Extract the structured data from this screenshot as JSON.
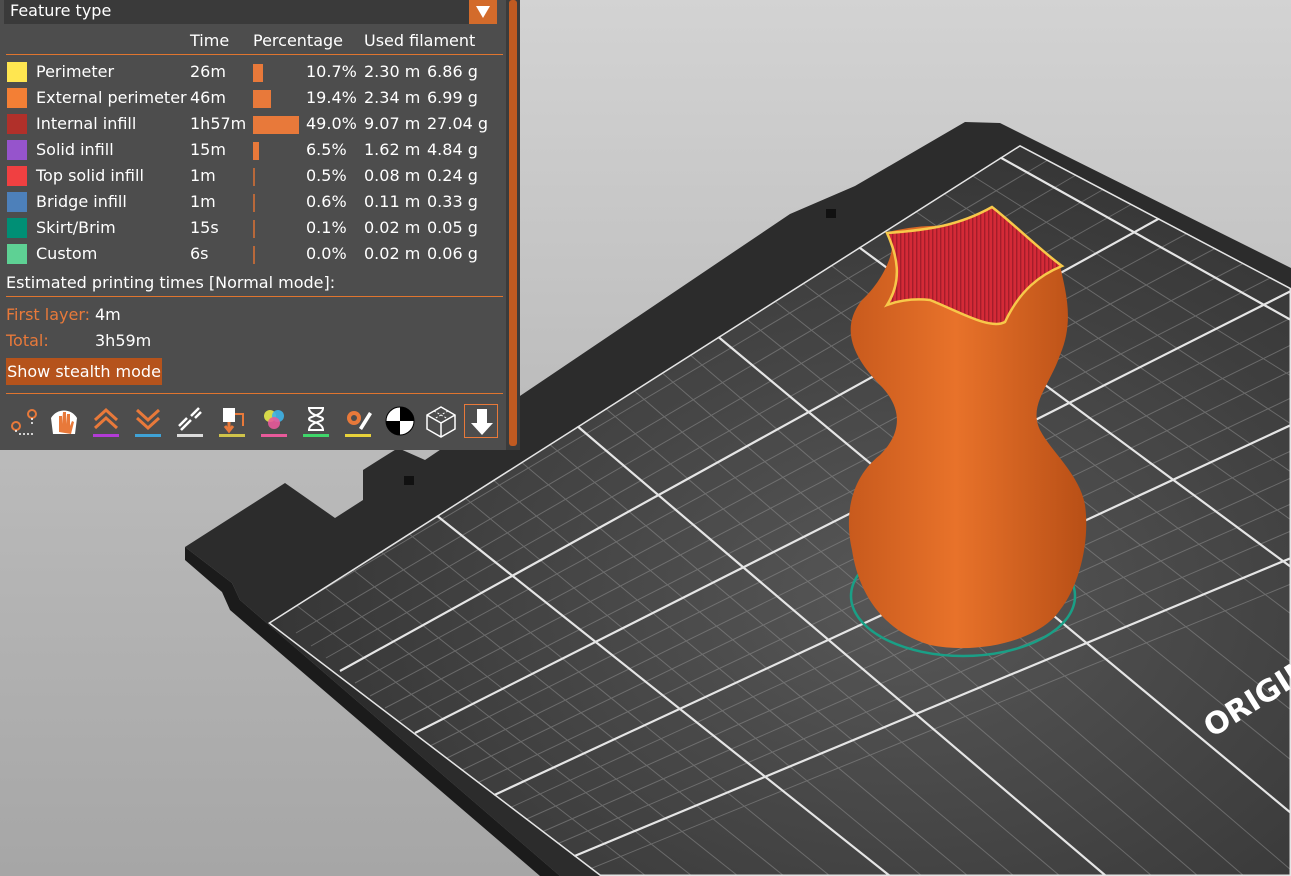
{
  "legend": {
    "dropdown_label": "Feature type",
    "headers": {
      "time": "Time",
      "percentage": "Percentage",
      "used_filament": "Used filament"
    },
    "rows": [
      {
        "name": "Perimeter",
        "time": "26m",
        "percent": "10.7%",
        "length": "2.30 m",
        "weight": "6.86 g",
        "color": "#ffe650",
        "fraction": 0.107
      },
      {
        "name": "External perimeter",
        "time": "46m",
        "percent": "19.4%",
        "length": "2.34 m",
        "weight": "6.99 g",
        "color": "#f37f35",
        "fraction": 0.194
      },
      {
        "name": "Internal infill",
        "time": "1h57m",
        "percent": "49.0%",
        "length": "9.07 m",
        "weight": "27.04 g",
        "color": "#b1302a",
        "fraction": 0.49
      },
      {
        "name": "Solid infill",
        "time": "15m",
        "percent": "6.5%",
        "length": "1.62 m",
        "weight": "4.84 g",
        "color": "#9654cc",
        "fraction": 0.065
      },
      {
        "name": "Top solid infill",
        "time": "1m",
        "percent": "0.5%",
        "length": "0.08 m",
        "weight": "0.24 g",
        "color": "#f04041",
        "fraction": 0.005
      },
      {
        "name": "Bridge infill",
        "time": "1m",
        "percent": "0.6%",
        "length": "0.11 m",
        "weight": "0.33 g",
        "color": "#4d80ba",
        "fraction": 0.006
      },
      {
        "name": "Skirt/Brim",
        "time": "15s",
        "percent": "0.1%",
        "length": "0.02 m",
        "weight": "0.05 g",
        "color": "#008f75",
        "fraction": 0.001
      },
      {
        "name": "Custom",
        "time": "6s",
        "percent": "0.0%",
        "length": "0.02 m",
        "weight": "0.06 g",
        "color": "#5ed194",
        "fraction": 0.0
      }
    ]
  },
  "estimates": {
    "heading": "Estimated printing times [Normal mode]:",
    "first_layer_label": "First layer:",
    "first_layer_value": "4m",
    "total_label": "Total:",
    "total_value": "3h59m",
    "stealth_button": "Show stealth mode"
  },
  "toolbar": {
    "icons": [
      "travel-icon",
      "wipe-icon",
      "retractions-icon",
      "deretractions-icon",
      "seams-icon",
      "tool-changes-icon",
      "color-changes-icon",
      "pause-prints-icon",
      "custom-gcodes-icon",
      "center-of-gravity-icon",
      "shells-icon",
      "tool-marker-icon"
    ]
  },
  "scene": {
    "bed_text": "ORIGIN"
  },
  "colors": {
    "accent": "#e8793a",
    "panel_bg": "#4d4d4d",
    "model": "#e36e27",
    "top_face": "#d52a37"
  }
}
